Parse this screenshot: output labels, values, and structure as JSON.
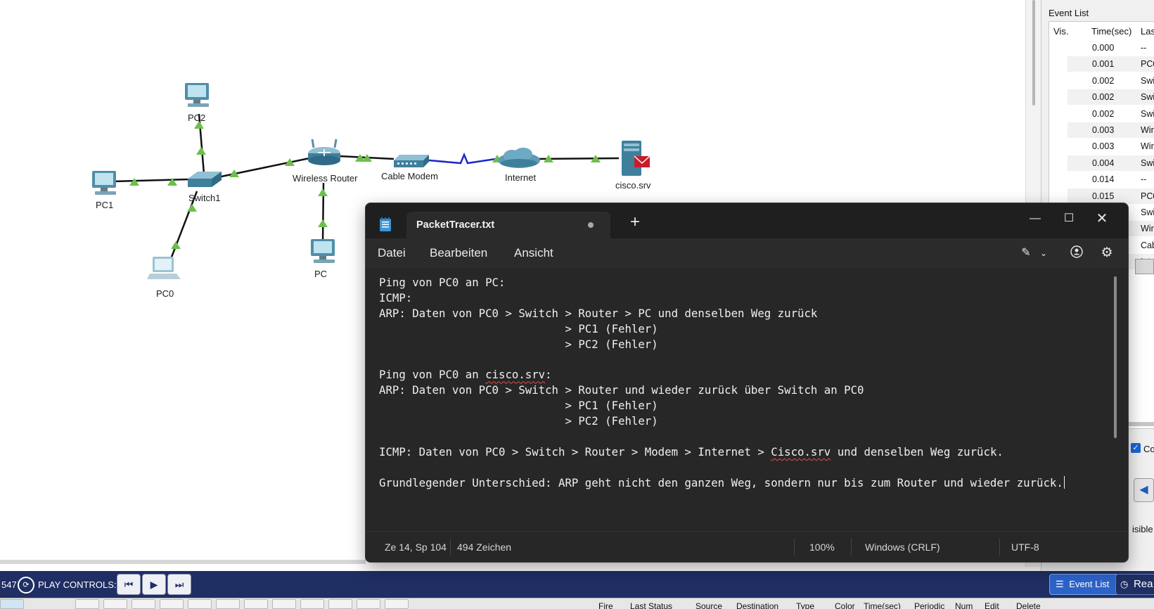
{
  "workspace": {
    "devices": {
      "pc2": "PC2",
      "pc1": "PC1",
      "pc0": "PC0",
      "switch1": "Switch1",
      "wireless_router": "Wireless Router",
      "cable_modem": "Cable Modem",
      "internet": "Internet",
      "pc": "PC",
      "cisco_srv": "cisco.srv"
    }
  },
  "event_list": {
    "title": "Event List",
    "columns": {
      "vis": "Vis.",
      "time": "Time(sec)",
      "last": "Las"
    },
    "rows": [
      {
        "time": "0.000",
        "last": "--"
      },
      {
        "time": "0.001",
        "last": "PC0"
      },
      {
        "time": "0.002",
        "last": "Swi"
      },
      {
        "time": "0.002",
        "last": "Swi"
      },
      {
        "time": "0.002",
        "last": "Swi"
      },
      {
        "time": "0.003",
        "last": "Wir"
      },
      {
        "time": "0.003",
        "last": "Wir"
      },
      {
        "time": "0.004",
        "last": "Swi"
      },
      {
        "time": "0.014",
        "last": "--"
      },
      {
        "time": "0.015",
        "last": "PC0"
      },
      {
        "time": "",
        "last": "Swi"
      },
      {
        "time": "",
        "last": "Wir"
      },
      {
        "time": "",
        "last": "Cab"
      },
      {
        "time": "",
        "last": "Inte"
      }
    ],
    "checkbox_label": "Co",
    "visible_label": "isible"
  },
  "bottom_bar": {
    "counter": "547",
    "play_controls_label": "PLAY CONTROLS:",
    "event_list_button": "Event List",
    "realtime_button": "Rea"
  },
  "pdu_table": {
    "columns": [
      "Fire",
      "Last Status",
      "Source",
      "Destination",
      "Type",
      "Color",
      "Time(sec)",
      "Periodic",
      "Num",
      "Edit",
      "Delete"
    ]
  },
  "notepad": {
    "tab_title": "PacketTracer.txt",
    "menu": {
      "file": "Datei",
      "edit": "Bearbeiten",
      "view": "Ansicht"
    },
    "text": {
      "l1": "Ping von PC0 an PC:",
      "l2": "ICMP:",
      "l3": "ARP: Daten von PC0 > Switch > Router > PC und denselben Weg zurück",
      "l4": "                            > PC1 (Fehler)",
      "l5": "                            > PC2 (Fehler)",
      "l7a": "Ping von PC0 an ",
      "l7b": "cisco.srv",
      "l7c": ":",
      "l8": "ARP: Daten von PC0 > Switch > Router und wieder zurück über Switch an PC0",
      "l9": "                            > PC1 (Fehler)",
      "l10": "                            > PC2 (Fehler)",
      "l12a": "ICMP: Daten von PC0 > Switch > Router > Modem > Internet > ",
      "l12b": "Cisco.srv",
      "l12c": " und denselben Weg zurück.",
      "l14": "Grundlegender Unterschied: ARP geht nicht den ganzen Weg, sondern nur bis zum Router und wieder zurück."
    },
    "status": {
      "position": "Ze 14, Sp 104",
      "chars": "494 Zeichen",
      "zoom": "100%",
      "line_ending": "Windows (CRLF)",
      "encoding": "UTF-8"
    }
  }
}
